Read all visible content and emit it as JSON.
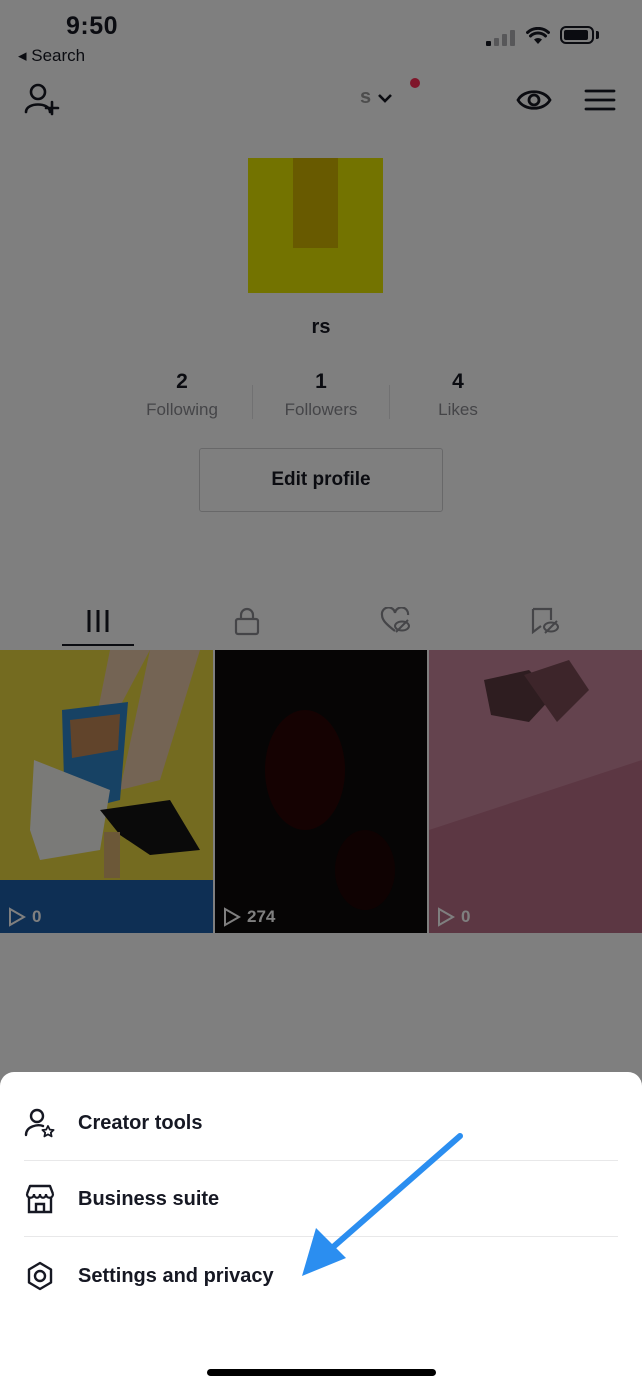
{
  "status_bar": {
    "time": "9:50",
    "back_label": "◂ Search"
  },
  "header": {
    "username_fragment": "s",
    "add_friend_icon": "person-plus-icon",
    "eye_icon": "eye-icon",
    "menu_icon": "hamburger-icon"
  },
  "profile": {
    "name_fragment": "rs",
    "stats": [
      {
        "value": "2",
        "label": "Following"
      },
      {
        "value": "1",
        "label": "Followers"
      },
      {
        "value": "4",
        "label": "Likes"
      }
    ],
    "edit_button": "Edit profile"
  },
  "tabs": [
    "videos-grid-icon",
    "private-lock-icon",
    "liked-hidden-icon",
    "favorites-hidden-icon"
  ],
  "videos": [
    {
      "views": "0"
    },
    {
      "views": "274"
    },
    {
      "views": "0"
    }
  ],
  "sheet": {
    "items": [
      {
        "label": "Creator tools",
        "icon": "creator-tools-icon"
      },
      {
        "label": "Business suite",
        "icon": "storefront-icon"
      },
      {
        "label": "Settings and privacy",
        "icon": "gear-icon"
      }
    ]
  },
  "colors": {
    "accent_dot": "#fe2c55",
    "annotation_arrow": "#2b8ef0"
  }
}
